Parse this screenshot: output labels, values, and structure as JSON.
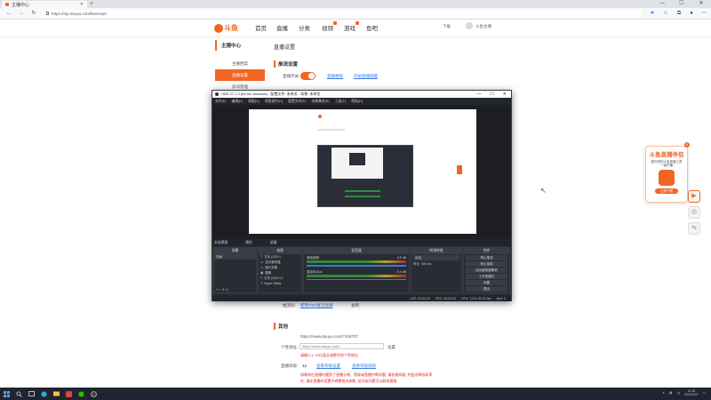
{
  "browser": {
    "tab_title": "主播中心",
    "url": "https://mp.douyu.com/live/main",
    "window_controls": [
      "—",
      "☐",
      "✕"
    ]
  },
  "site": {
    "logo_text": "斗鱼",
    "nav": [
      "首页",
      "直播",
      "分类",
      "视频",
      "游戏",
      "鱼吧"
    ],
    "header_right": [
      "下载",
      "斗鱼主播"
    ]
  },
  "sidebar": {
    "title": "主播中心",
    "items": [
      "主播档案",
      "直播设置",
      "房间管理"
    ]
  },
  "main": {
    "page_title": "直播设置",
    "section_live": "推流设置",
    "toggle_label": "直播开关:",
    "toggle_links": [
      "直播教程",
      "开始直播提醒"
    ],
    "obs_note_label": "推流码:",
    "obs_note_link": "使用OBS推流直播",
    "obs_note_value": "复制",
    "section_other": "其他",
    "room_url": "https://www.douyu.com/7426707",
    "room_label": "个性地址:",
    "room_input": "https://www.douyu.com/",
    "room_btn": "设置",
    "room_hint": "请输入1~10位英文或数字的个性地址",
    "level_label": "直播等级:",
    "level_value": "12",
    "level_links": [
      "查看等级设置",
      "查看等级规则"
    ],
    "warnings": [
      "如果你在直播时遇到了直播卡顿、黑屏或直播中断问题, 请检查网络, 并尝试降低码率",
      "在, 请在直播间设置中调整相关参数, 若仍有问题可以联系客服"
    ]
  },
  "obs": {
    "title": "OBS 27.1.3 (64 bit, windows) - 配置文件: 未命名 - 场景: 未命名",
    "menu": [
      "文件(F)",
      "编辑(E)",
      "视图(V)",
      "停靠部件(D)",
      "配置文件(P)",
      "场景集合(S)",
      "工具(T)",
      "帮助(H)"
    ],
    "scene_bar": [
      "未选择源",
      "属性",
      "滤镜"
    ],
    "docks": {
      "scenes": {
        "title": "场景",
        "items": [
          "场景"
        ]
      },
      "sources": {
        "title": "来源",
        "items": [
          "文本 (GDI+)",
          "显示器采集",
          "窗口采集",
          "图像",
          "文本 (GDI+) 2",
          "Super Stella"
        ]
      },
      "mixer": {
        "title": "混音器",
        "channels": [
          "桌面音频",
          "麦克风/Aux"
        ],
        "levels": [
          "0.0 dB",
          "0.0 dB"
        ]
      },
      "transitions": {
        "title": "转场特效",
        "type": "淡出",
        "duration_label": "时长",
        "duration": "300 ms"
      },
      "controls": {
        "title": "控件",
        "buttons": [
          "停止推流",
          "停止录制",
          "启动虚拟摄像机",
          "工作室模式",
          "设置",
          "退出"
        ]
      }
    },
    "status": [
      "LIVE: 00:00:00",
      "REC: 00:00:00",
      "CPU: 1.9%, 60.00 fps",
      "kb/s: 0"
    ]
  },
  "helper": {
    "title": "斗鱼直播伴侣",
    "subtitle": "超好用的斗鱼直播工具\n一键开播",
    "download": "立即下载"
  },
  "taskbar": {
    "time": "11:28",
    "date": "2022/1/27"
  },
  "colors": {
    "brand": "#f26622",
    "obs_bg": "#2b2e38",
    "link": "#3b7ee6",
    "warning": "#e02020"
  }
}
